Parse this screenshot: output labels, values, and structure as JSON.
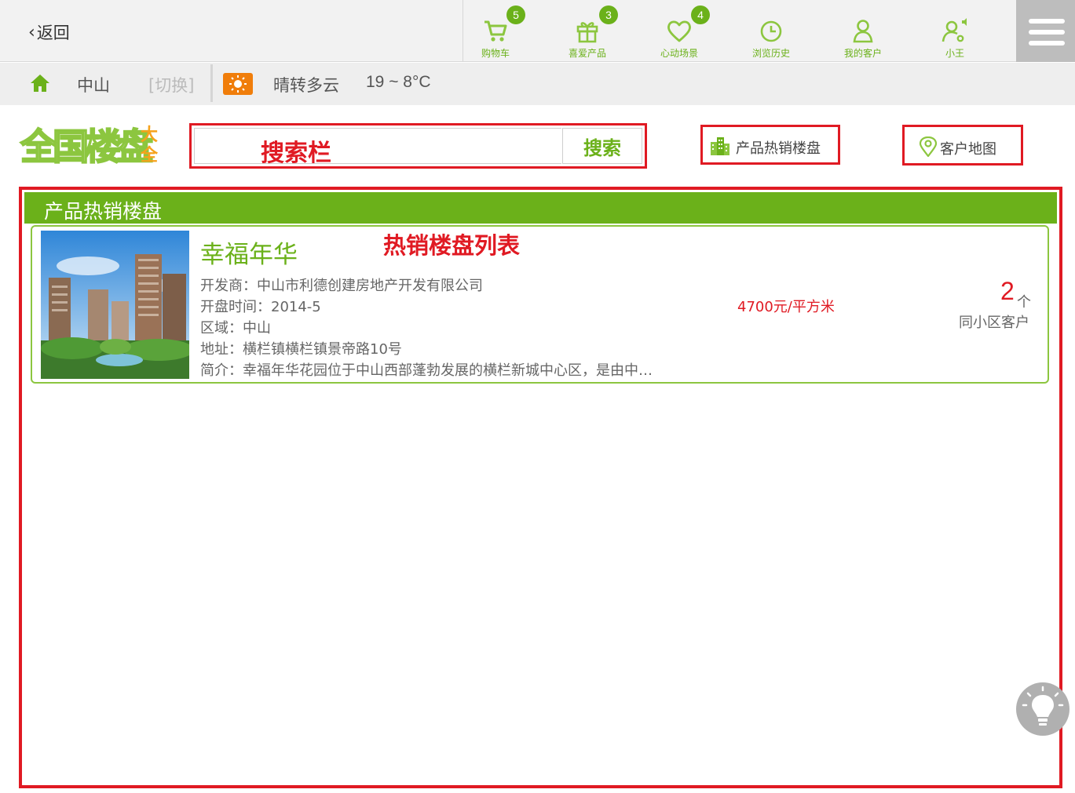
{
  "topbar": {
    "back_label": "返回",
    "nav": [
      {
        "label": "购物车",
        "badge": "5",
        "icon": "cart-icon"
      },
      {
        "label": "喜爱产品",
        "badge": "3",
        "icon": "gift-icon"
      },
      {
        "label": "心动场景",
        "badge": "4",
        "icon": "heart-icon"
      },
      {
        "label": "浏览历史",
        "badge": "",
        "icon": "clock-icon"
      },
      {
        "label": "我的客户",
        "badge": "",
        "icon": "user-icon"
      },
      {
        "label": "小王",
        "badge": "",
        "icon": "user-settings-icon"
      }
    ],
    "menu_icon": "hamburger-menu-icon"
  },
  "location": {
    "city": "中山",
    "switch_label": "[切换]",
    "weather": "晴转多云",
    "temperature": "19 ~ 8°C"
  },
  "logo": {
    "main": "全国楼盘",
    "sub": "大全"
  },
  "search": {
    "annotation": "搜索栏",
    "button_label": "搜索",
    "placeholder": ""
  },
  "actions": {
    "hot_label": "产品热销楼盘",
    "map_label": "客户地图"
  },
  "list": {
    "header": "产品热销楼盘",
    "annotation": "热销楼盘列表",
    "items": [
      {
        "name": "幸福年华",
        "developer": "开发商：中山市利德创建房地产开发有限公司",
        "open_date": "开盘时间：2014-5",
        "region": "区域：中山",
        "address": "地址：横栏镇横栏镇景帝路10号",
        "intro": "简介：幸福年华花园位于中山西部蓬勃发展的横栏新城中心区，是由中…",
        "price": "4700元/平方米",
        "customer_count": "2",
        "customer_unit": "个",
        "customer_label": "同小区客户"
      }
    ]
  },
  "colors": {
    "brand_green": "#6bb11a",
    "annotation_red": "#e01a23",
    "weather_orange": "#f07d0a"
  }
}
